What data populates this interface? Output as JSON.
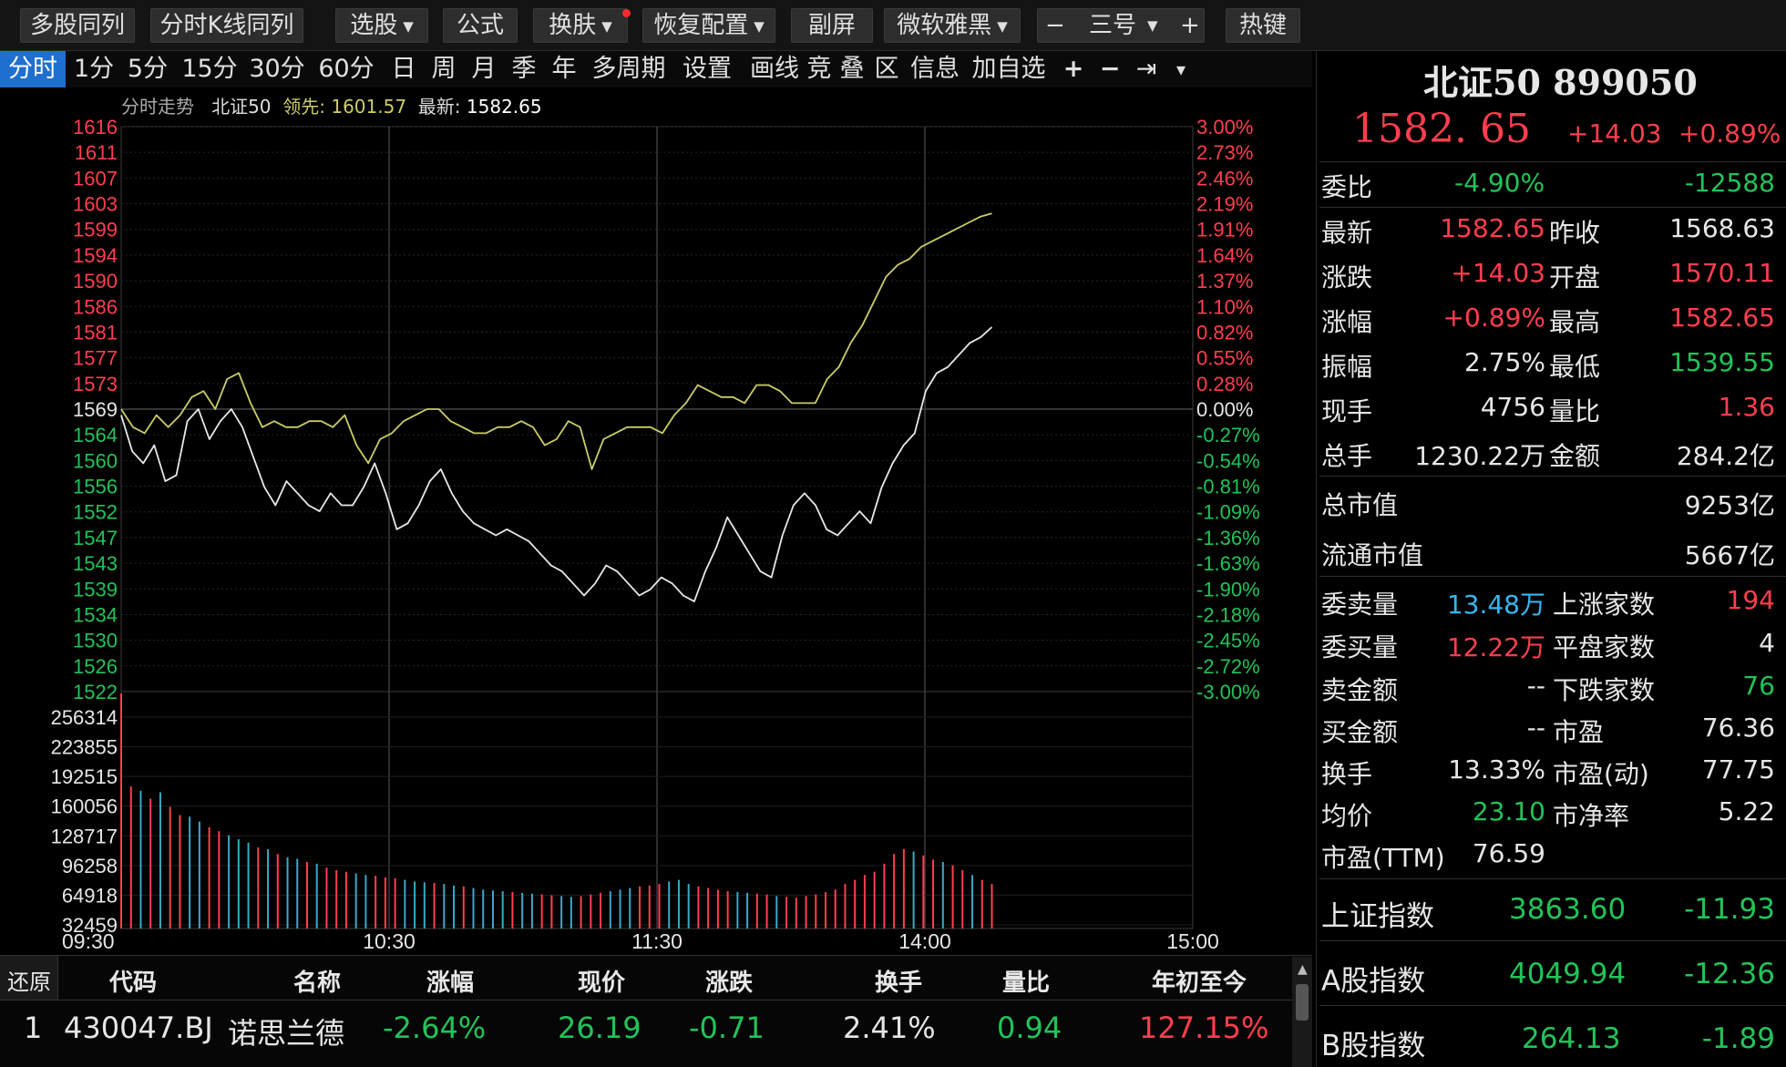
{
  "toolbar": {
    "items": [
      "多股同列",
      "分时K线同列",
      "选股",
      "公式",
      "换肤",
      "恢复配置",
      "副屏",
      "微软雅黑",
      "三号",
      "热键"
    ],
    "minus": "−",
    "plus": "+"
  },
  "periods": [
    "分时",
    "1分",
    "5分",
    "15分",
    "30分",
    "60分",
    "日",
    "周",
    "月",
    "季",
    "年",
    "多周期",
    "设置",
    "画线",
    "竞",
    "叠",
    "区",
    "信息",
    "加自选",
    "+",
    "−",
    "⇥",
    "▾"
  ],
  "header": {
    "label": "分时走势",
    "index_name": "北证50",
    "lead_label": "领先:",
    "lead_value": "1601.57",
    "latest_label": "最新:",
    "latest_value": "1582.65"
  },
  "colors": {
    "up": "#ff3e4e",
    "down": "#22c35a",
    "price_line": "#e8e8e8",
    "lead_line": "#cccc66",
    "grid": "#3c3c3c",
    "active_tab": "#1f6fd1"
  },
  "chart_data": {
    "type": "line",
    "title": "北证50",
    "ylim": [
      1522,
      1616
    ],
    "prev_close": 1568.63,
    "price_ticks": [
      "1616",
      "1611",
      "1607",
      "1603",
      "1599",
      "1594",
      "1590",
      "1586",
      "1581",
      "1577",
      "1573",
      "1569",
      "1564",
      "1560",
      "1556",
      "1552",
      "1547",
      "1543",
      "1539",
      "1534",
      "1530",
      "1526",
      "1522"
    ],
    "pct_ticks": [
      "3.00%",
      "2.73%",
      "2.46%",
      "2.19%",
      "1.91%",
      "1.64%",
      "1.37%",
      "1.10%",
      "0.82%",
      "0.55%",
      "0.28%",
      "0.00%",
      "-0.27%",
      "-0.54%",
      "-0.81%",
      "-1.09%",
      "-1.36%",
      "-1.63%",
      "-1.90%",
      "-2.18%",
      "-2.45%",
      "-2.72%",
      "-3.00%"
    ],
    "time_ticks": [
      "09:30",
      "10:30",
      "11:30",
      "14:00",
      "15:00"
    ],
    "volume_ticks": [
      "256314",
      "223855",
      "192515",
      "160056",
      "128717",
      "96258",
      "64918",
      "32459"
    ],
    "volume_max": 290000,
    "total_minutes": 240,
    "series": [
      {
        "name": "最新",
        "values": [
          1568,
          1562,
          1560,
          1563,
          1557,
          1558,
          1567,
          1569,
          1564,
          1567,
          1569,
          1566,
          1561,
          1556,
          1553,
          1557,
          1555,
          1553,
          1552,
          1555,
          1553,
          1553,
          1556,
          1560,
          1555,
          1549,
          1550,
          1553,
          1557,
          1559,
          1555,
          1552,
          1550,
          1549,
          1548,
          1549,
          1548,
          1547,
          1545,
          1543,
          1542,
          1540,
          1538,
          1540,
          1543,
          1542,
          1540,
          1538,
          1539,
          1541,
          1540,
          1538,
          1537,
          1542,
          1546,
          1551,
          1548,
          1545,
          1542,
          1541,
          1548,
          1553,
          1555,
          1553,
          1549,
          1548,
          1550,
          1552,
          1550,
          1556,
          1560,
          1563,
          1565,
          1572,
          1575,
          1576,
          1578,
          1580,
          1581,
          1582.65
        ]
      },
      {
        "name": "领先",
        "values": [
          1569,
          1566,
          1565,
          1568,
          1566,
          1568,
          1571,
          1572,
          1569,
          1574,
          1575,
          1570,
          1566,
          1567,
          1566,
          1566,
          1567,
          1567,
          1566,
          1568,
          1563,
          1560,
          1564,
          1565,
          1567,
          1568,
          1569,
          1569,
          1567,
          1566,
          1565,
          1565,
          1566,
          1566,
          1567,
          1566,
          1563,
          1564,
          1567,
          1566,
          1559,
          1564,
          1565,
          1566,
          1566,
          1566,
          1565,
          1568,
          1570,
          1573,
          1572,
          1571,
          1571,
          1570,
          1573,
          1573,
          1572,
          1570,
          1570,
          1570,
          1574,
          1576,
          1580,
          1583,
          1587,
          1591,
          1593,
          1594,
          1596,
          1597,
          1598,
          1599,
          1600,
          1601,
          1601.57
        ]
      }
    ],
    "volume": {
      "values": [
        290000,
        175000,
        170000,
        160000,
        168000,
        150000,
        140000,
        138000,
        132000,
        125000,
        120000,
        115000,
        110000,
        106000,
        100000,
        98000,
        92000,
        88000,
        86000,
        82000,
        80000,
        75000,
        72000,
        70000,
        68000,
        66000,
        65000,
        63000,
        62000,
        60000,
        58000,
        57000,
        56000,
        55000,
        53000,
        52000,
        50000,
        48000,
        47000,
        46000,
        45000,
        44000,
        43000,
        42000,
        41000,
        40000,
        39000,
        40000,
        42000,
        44000,
        46000,
        48000,
        50000,
        52000,
        53000,
        55000,
        58000,
        60000,
        55000,
        52000,
        50000,
        48000,
        46000,
        45000,
        44000,
        43000,
        42000,
        40000,
        39000,
        38000,
        40000,
        42000,
        45000,
        48000,
        55000,
        60000,
        66000,
        70000,
        80000,
        92000,
        98000,
        95000,
        90000,
        85000,
        82000,
        78000,
        72000,
        66000,
        60000,
        55000
      ],
      "up_flags": [
        1,
        1,
        0,
        1,
        0,
        1,
        1,
        0,
        0,
        1,
        1,
        0,
        0,
        0,
        1,
        0,
        1,
        0,
        0,
        1,
        0,
        1,
        1,
        1,
        0,
        0,
        1,
        1,
        1,
        0,
        0,
        0,
        1,
        0,
        0,
        1,
        0,
        0,
        0,
        0,
        1,
        0,
        0,
        1,
        1,
        0,
        0,
        1,
        1,
        1,
        0,
        0,
        0,
        1,
        1,
        1,
        0,
        0,
        0,
        1,
        1,
        1,
        1,
        0,
        0,
        1,
        1,
        0,
        1,
        1,
        1,
        1,
        1,
        1,
        1,
        1,
        1,
        1,
        1,
        1,
        1,
        0,
        1,
        1,
        0,
        1,
        1,
        0,
        1,
        1
      ]
    }
  },
  "right": {
    "title": "北证50 899050",
    "price": "1582. 65",
    "change": "+14.03",
    "change_pct": "+0.89%",
    "rows": [
      {
        "l": "委比",
        "v": "-4.90%",
        "v2": "-12588"
      },
      {
        "l": "最新",
        "v": "1582.65",
        "l2": "昨收",
        "v2": "1568.63"
      },
      {
        "l": "涨跌",
        "v": "+14.03",
        "l2": "开盘",
        "v2": "1570.11"
      },
      {
        "l": "涨幅",
        "v": "+0.89%",
        "l2": "最高",
        "v2": "1582.65"
      },
      {
        "l": "振幅",
        "v": "2.75%",
        "l2": "最低",
        "v2": "1539.55"
      },
      {
        "l": "现手",
        "v": "4756",
        "l2": "量比",
        "v2": "1.36"
      },
      {
        "l": "总手",
        "v": "1230.22万",
        "l2": "金额",
        "v2": "284.2亿"
      }
    ],
    "total_cap": {
      "l": "总市值",
      "v": "9253亿"
    },
    "float_cap": {
      "l": "流通市值",
      "v": "5667亿"
    },
    "rows2": [
      {
        "l": "委卖量",
        "v": "13.48万",
        "l2": "上涨家数",
        "v2": "194"
      },
      {
        "l": "委买量",
        "v": "12.22万",
        "l2": "平盘家数",
        "v2": "4"
      },
      {
        "l": "卖金额",
        "v": "--",
        "l2": "下跌家数",
        "v2": "76"
      },
      {
        "l": "买金额",
        "v": "--",
        "l2": "市盈",
        "v2": "76.36"
      },
      {
        "l": "换手",
        "v": "13.33%",
        "l2": "市盈(动)",
        "v2": "77.75"
      },
      {
        "l": "均价",
        "v": "23.10",
        "l2": "市净率",
        "v2": "5.22"
      },
      {
        "l": "市盈(TTM)",
        "v": "76.59"
      }
    ],
    "indices": [
      {
        "name": "上证指数",
        "value": "3863.60",
        "change": "-11.93"
      },
      {
        "name": "A股指数",
        "value": "4049.94",
        "change": "-12.36"
      },
      {
        "name": "B股指数",
        "value": "264.13",
        "change": "-1.89"
      }
    ]
  },
  "table": {
    "restore": "还原",
    "headers": [
      "代码",
      "名称",
      "涨幅",
      "现价",
      "涨跌",
      "换手",
      "量比",
      "年初至今"
    ],
    "row": {
      "idx": "1",
      "code": "430047.BJ",
      "name": "诺思兰德",
      "pct": "-2.64%",
      "price": "26.19",
      "chg": "-0.71",
      "turnover": "2.41%",
      "vol_ratio": "0.94",
      "ytd": "127.15%"
    }
  }
}
